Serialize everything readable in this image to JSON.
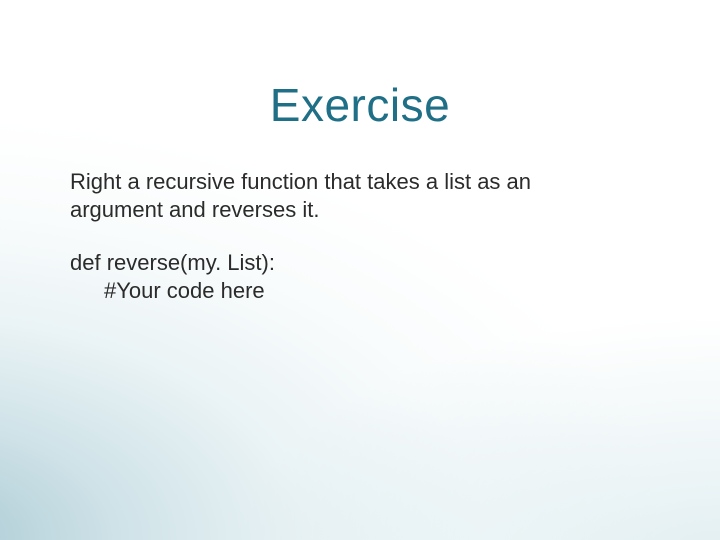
{
  "slide": {
    "title": "Exercise",
    "prompt": "Right a recursive function that takes a list as an argument and reverses it.",
    "code": {
      "line1": "def reverse(my. List):",
      "line2": "#Your code here"
    }
  }
}
